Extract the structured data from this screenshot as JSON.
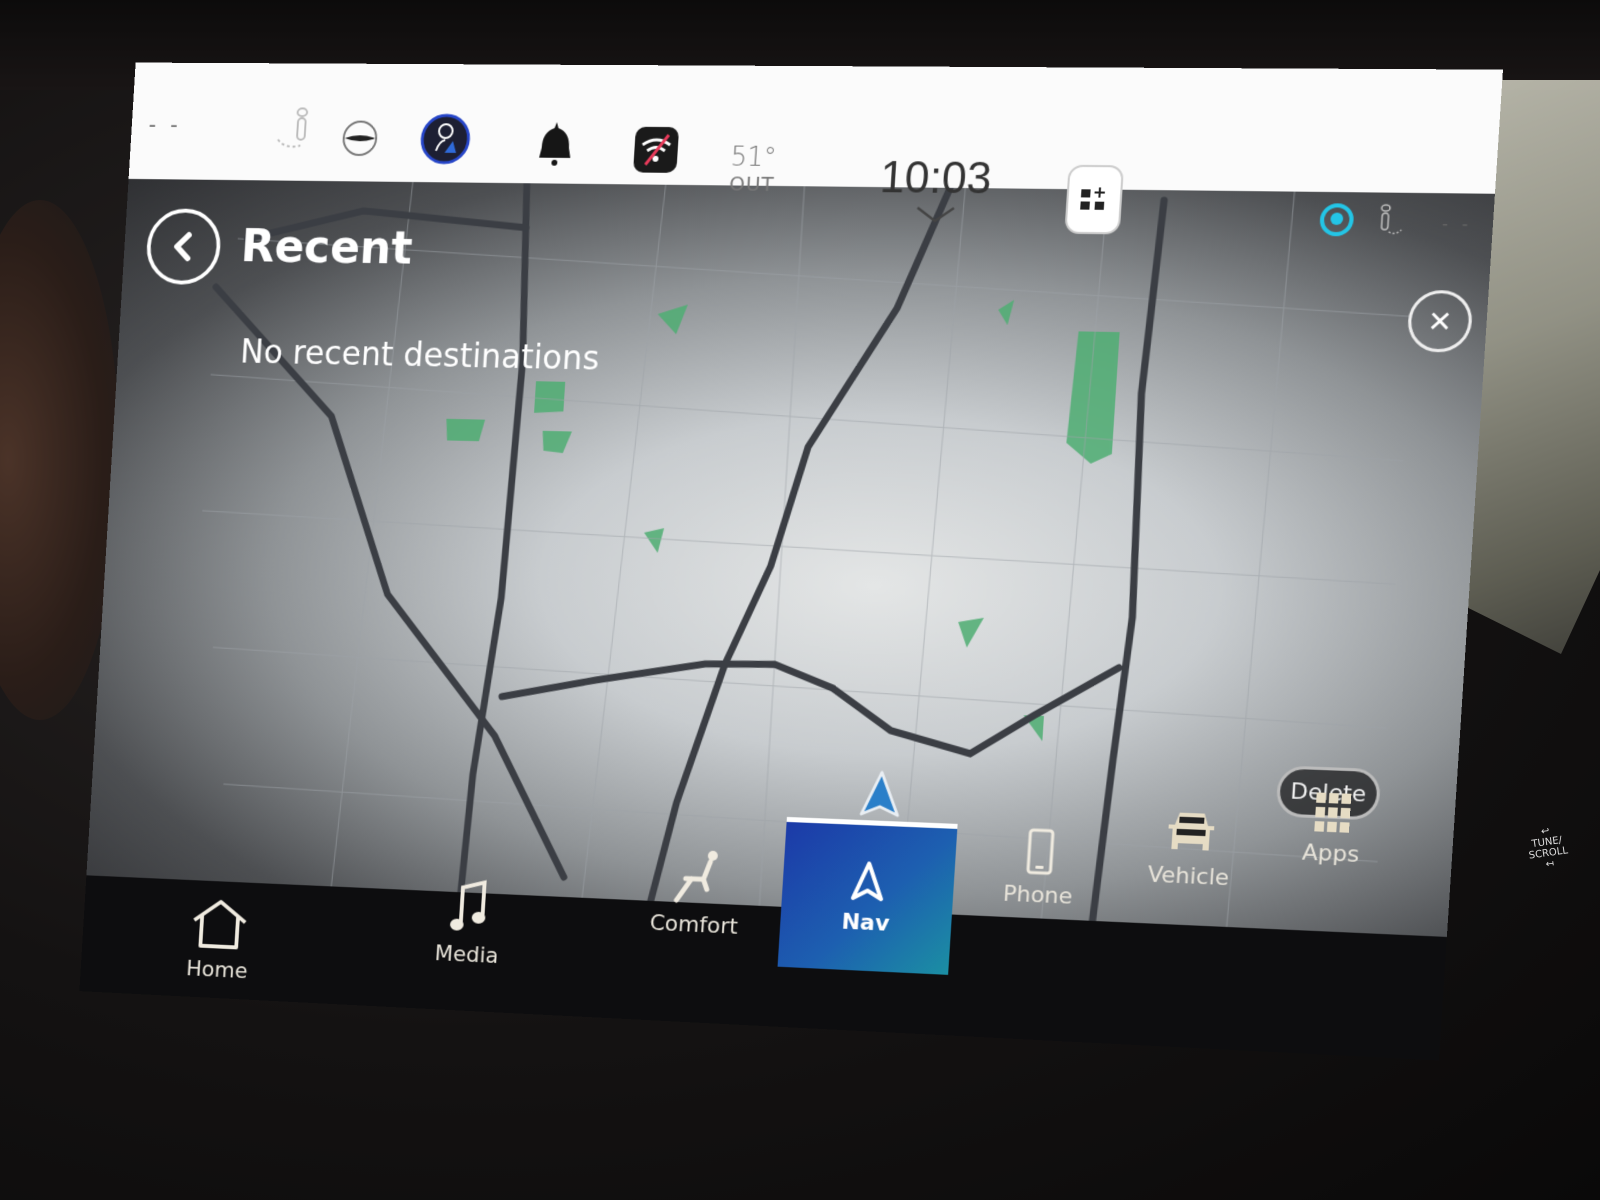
{
  "status_bar": {
    "left_placeholder": "- -",
    "right_placeholder": "- -",
    "temperature": "51°",
    "temperature_label": "OUT",
    "time": "10:03",
    "icons": [
      "seat-heat-driver-icon",
      "steering-wheel-heat-icon",
      "driver-profile-icon",
      "notifications-bell-icon",
      "wifi-off-icon",
      "widget-add-icon",
      "voice-assistant-icon",
      "seat-heat-passenger-icon"
    ],
    "colors": {
      "background": "#fbfbfb",
      "assistant_ring": "#23c5e6",
      "profile_ring": "#2746c8",
      "wifi_slash": "#e83a5a"
    }
  },
  "header": {
    "title": "Recent",
    "back_icon": "chevron-left-icon",
    "close_icon": "close-icon"
  },
  "main": {
    "empty_message": "No recent destinations",
    "delete_label": "Delete"
  },
  "nav": {
    "items": [
      {
        "label": "Home",
        "icon": "home-icon",
        "active": false
      },
      {
        "label": "Media",
        "icon": "music-note-icon",
        "active": false
      },
      {
        "label": "Comfort",
        "icon": "seat-comfort-icon",
        "active": false
      },
      {
        "label": "Nav",
        "icon": "navigation-arrow-icon",
        "active": true
      },
      {
        "label": "Phone",
        "icon": "smartphone-icon",
        "active": false
      },
      {
        "label": "Vehicle",
        "icon": "vehicle-icon",
        "active": false
      },
      {
        "label": "Apps",
        "icon": "apps-grid-icon",
        "active": false
      }
    ],
    "accent": "#1d5fb0"
  },
  "hardware": {
    "tune_scroll_label_1": "TUNE/",
    "tune_scroll_label_2": "SCROLL"
  }
}
